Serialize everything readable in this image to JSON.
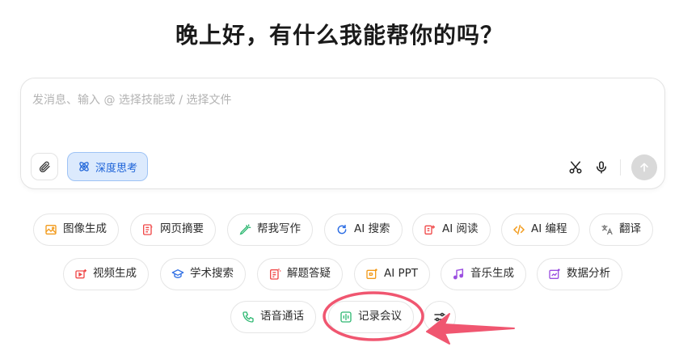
{
  "greeting": "晚上好，有什么我能帮你的吗？",
  "composer": {
    "placeholder": "发消息、输入 @ 选择技能或 / 选择文件",
    "deep_think_label": "深度思考"
  },
  "chips_row1": [
    {
      "label": "图像生成",
      "icon": "image-icon",
      "color": "#f29b1c"
    },
    {
      "label": "网页摘要",
      "icon": "doc-summary-icon",
      "color": "#f04848"
    },
    {
      "label": "帮我写作",
      "icon": "pen-icon",
      "color": "#2eb872"
    },
    {
      "label": "AI 搜索",
      "icon": "search-refresh-icon",
      "color": "#2f6fe4"
    },
    {
      "label": "AI 阅读",
      "icon": "reading-icon",
      "color": "#f04848"
    },
    {
      "label": "AI 编程",
      "icon": "code-icon",
      "color": "#f29b1c"
    },
    {
      "label": "翻译",
      "icon": "translate-icon",
      "color": "#7a7a7a"
    }
  ],
  "chips_row2": [
    {
      "label": "视频生成",
      "icon": "video-icon",
      "color": "#f04848"
    },
    {
      "label": "学术搜索",
      "icon": "graduation-cap-icon",
      "color": "#2f6fe4"
    },
    {
      "label": "解题答疑",
      "icon": "question-doc-icon",
      "color": "#f04848"
    },
    {
      "label": "AI PPT",
      "icon": "ppt-icon",
      "color": "#f29b1c"
    },
    {
      "label": "音乐生成",
      "icon": "music-note-icon",
      "color": "#9b4fe0"
    },
    {
      "label": "数据分析",
      "icon": "chart-doc-icon",
      "color": "#9b4fe0"
    }
  ],
  "chips_row3": [
    {
      "label": "语音通话",
      "icon": "phone-icon",
      "color": "#2eb872"
    },
    {
      "label": "记录会议",
      "icon": "audio-record-icon",
      "color": "#2eb872"
    }
  ],
  "colors": {
    "deep_think_bg": "#dceafd",
    "deep_think_text": "#1d63d8",
    "annotation": "#f05670"
  }
}
